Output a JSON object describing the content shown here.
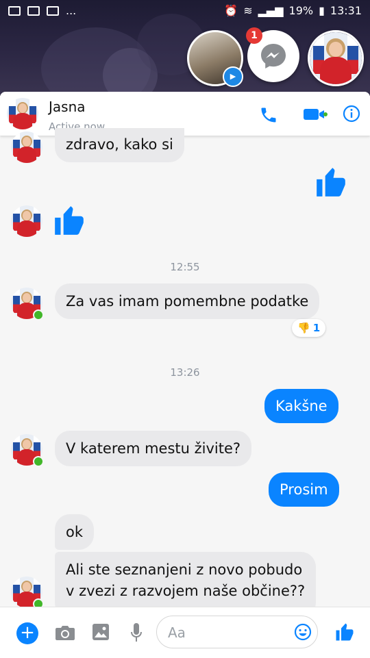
{
  "status_bar": {
    "left_text": "...",
    "battery": "19%",
    "time": "13:31"
  },
  "chat_heads": {
    "notification_count": "1"
  },
  "header": {
    "contact_name": "Jasna",
    "presence": "Active now"
  },
  "messages": [
    {
      "from": "contact",
      "text": "zdravo, kako si"
    },
    {
      "from": "me",
      "type": "like"
    },
    {
      "from": "contact",
      "type": "like"
    },
    {
      "type": "time",
      "text": "12:55"
    },
    {
      "from": "contact",
      "text": "Za vas imam pomembne podatke",
      "reaction_count": "1"
    },
    {
      "type": "time",
      "text": "13:26"
    },
    {
      "from": "me",
      "text": "Kakšne"
    },
    {
      "from": "contact",
      "text": "V katerem mestu živite?"
    },
    {
      "from": "me",
      "text": "Prosim"
    },
    {
      "from": "contact",
      "text": "ok"
    },
    {
      "from": "contact",
      "text_line1": "Ali ste seznanjeni z novo pobudo",
      "text_line2": "v zvezi z razvojem naše občine??"
    }
  ],
  "composer": {
    "placeholder": "Aa"
  },
  "colors": {
    "accent": "#0a84ff",
    "incoming_bubble": "#e9e9eb",
    "online": "#42b72a"
  }
}
